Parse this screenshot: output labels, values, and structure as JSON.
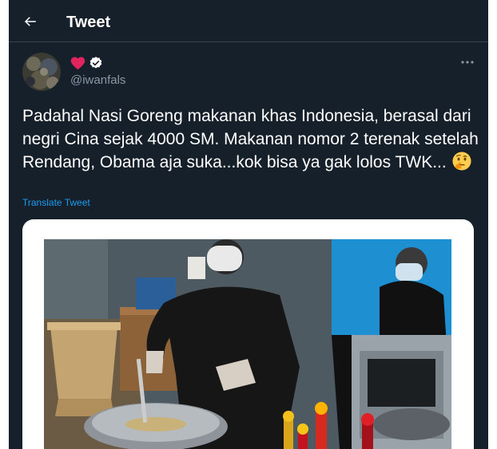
{
  "header": {
    "title": "Tweet",
    "back_icon": "arrow-left-icon"
  },
  "author": {
    "display_name_icons": [
      "red-heart-emoji",
      "verified-badge-icon"
    ],
    "handle": "@iwanfals"
  },
  "more_icon": "more-horizontal-icon",
  "tweet": {
    "text": "Padahal Nasi Goreng makanan khas Indonesia, berasal dari negri Cina sejak 4000 SM. Makanan nomor 2 terenak setelah Rendang, Obama aja suka...kok bisa ya gak lolos TWK...",
    "emoji": "thinking-face-emoji",
    "translate_label": "Translate Tweet"
  },
  "media": {
    "description_icon": "photo"
  },
  "colors": {
    "background": "#15202b",
    "border": "#38444d",
    "text": "#ffffff",
    "secondary_text": "#8899a6",
    "link": "#1d9bf0",
    "heart": "#f91880"
  }
}
